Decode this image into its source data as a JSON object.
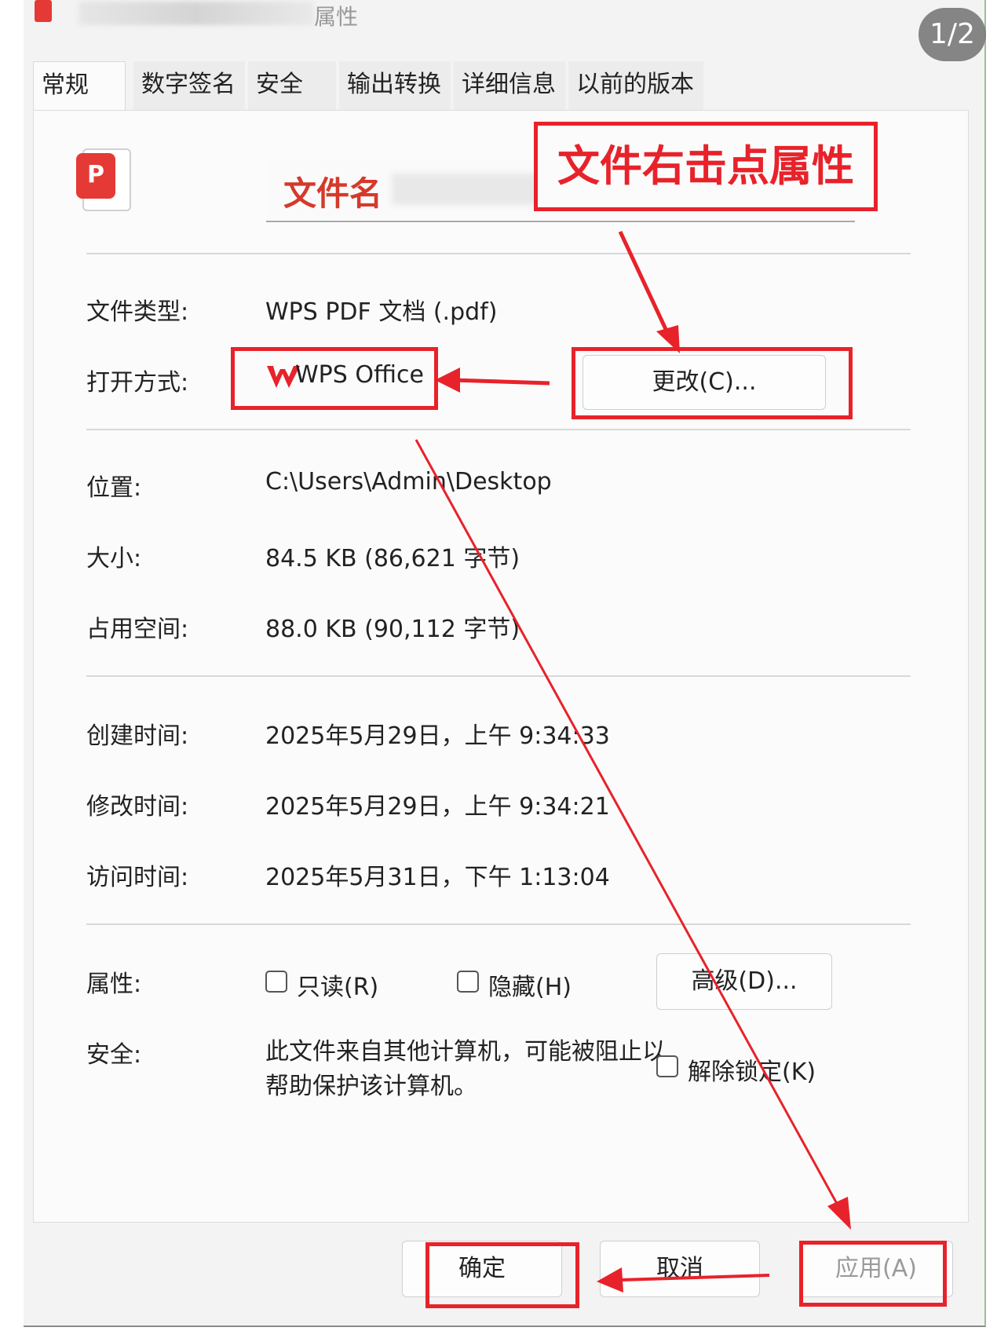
{
  "window": {
    "title_suffix": "属性",
    "page_counter": "1/2"
  },
  "tabs": [
    {
      "label": "常规"
    },
    {
      "label": "数字签名"
    },
    {
      "label": "安全"
    },
    {
      "label": "输出转换"
    },
    {
      "label": "详细信息"
    },
    {
      "label": "以前的版本"
    }
  ],
  "general": {
    "file_name": "文件名",
    "file_type_label": "文件类型:",
    "file_type_value": "WPS PDF 文档 (.pdf)",
    "open_with_label": "打开方式:",
    "open_with_value": "WPS Office",
    "change_button": "更改(C)...",
    "location_label": "位置:",
    "location_value": "C:\\Users\\Admin\\Desktop",
    "size_label": "大小:",
    "size_value": "84.5 KB (86,621 字节)",
    "disk_size_label": "占用空间:",
    "disk_size_value": "88.0 KB (90,112 字节)",
    "created_label": "创建时间:",
    "created_value": "2025年5月29日，上午 9:34:33",
    "modified_label": "修改时间:",
    "modified_value": "2025年5月29日，上午 9:34:21",
    "accessed_label": "访问时间:",
    "accessed_value": "2025年5月31日，下午 1:13:04",
    "attributes_label": "属性:",
    "readonly_label": "只读(R)",
    "hidden_label": "隐藏(H)",
    "advanced_button": "高级(D)...",
    "security_label": "安全:",
    "security_text": "此文件来自其他计算机，可能被阻止以帮助保护该计算机。",
    "unblock_label": "解除锁定(K)"
  },
  "footer": {
    "ok_button": "确定",
    "cancel_button": "取消",
    "apply_button": "应用(A)"
  },
  "annotation": {
    "callout_text": "文件右击点属性",
    "color": "#e8222a"
  },
  "icons": {
    "file_icon": "wps-pdf-file-icon",
    "app_icon": "wps-office-logo-icon"
  }
}
